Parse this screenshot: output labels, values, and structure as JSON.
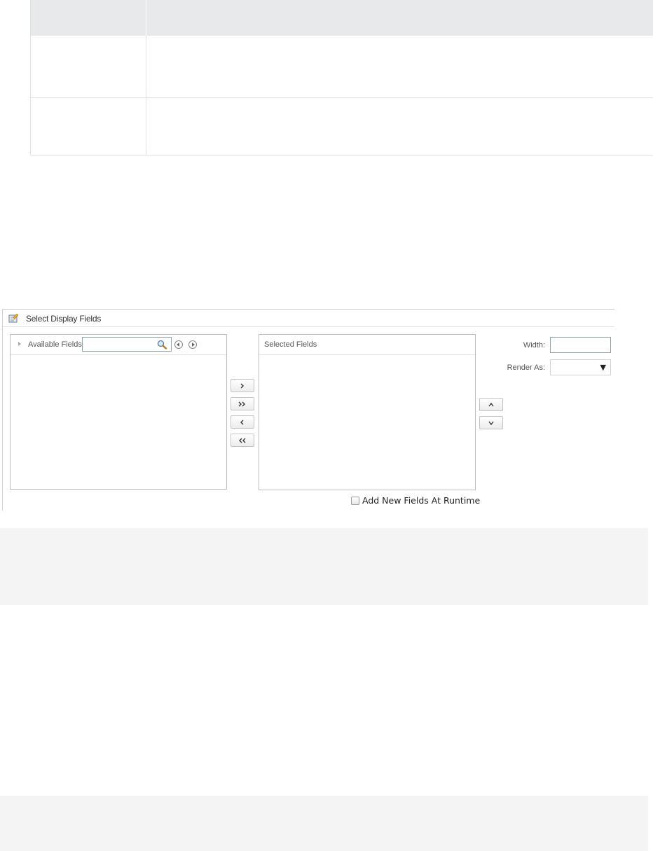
{
  "dialog": {
    "title": "Select Display Fields",
    "icon": "form-edit-icon",
    "available": {
      "label": "Available Fields",
      "search_value": "",
      "items": []
    },
    "selected": {
      "label": "Selected Fields",
      "items": []
    },
    "move_buttons": [
      {
        "name": "add-selected-button",
        "icon": "chevron-right-icon"
      },
      {
        "name": "add-all-button",
        "icon": "double-chevron-right-icon"
      },
      {
        "name": "remove-selected-button",
        "icon": "chevron-left-icon"
      },
      {
        "name": "remove-all-button",
        "icon": "double-chevron-left-icon"
      }
    ],
    "order_buttons": [
      {
        "name": "move-up-button",
        "icon": "chevron-up-icon"
      },
      {
        "name": "move-down-button",
        "icon": "chevron-down-icon"
      }
    ],
    "width_label": "Width:",
    "width_value": "",
    "render_as_label": "Render As:",
    "render_as_value": "",
    "runtime_checkbox_label": "Add New Fields At Runtime",
    "runtime_checkbox_checked": false
  }
}
